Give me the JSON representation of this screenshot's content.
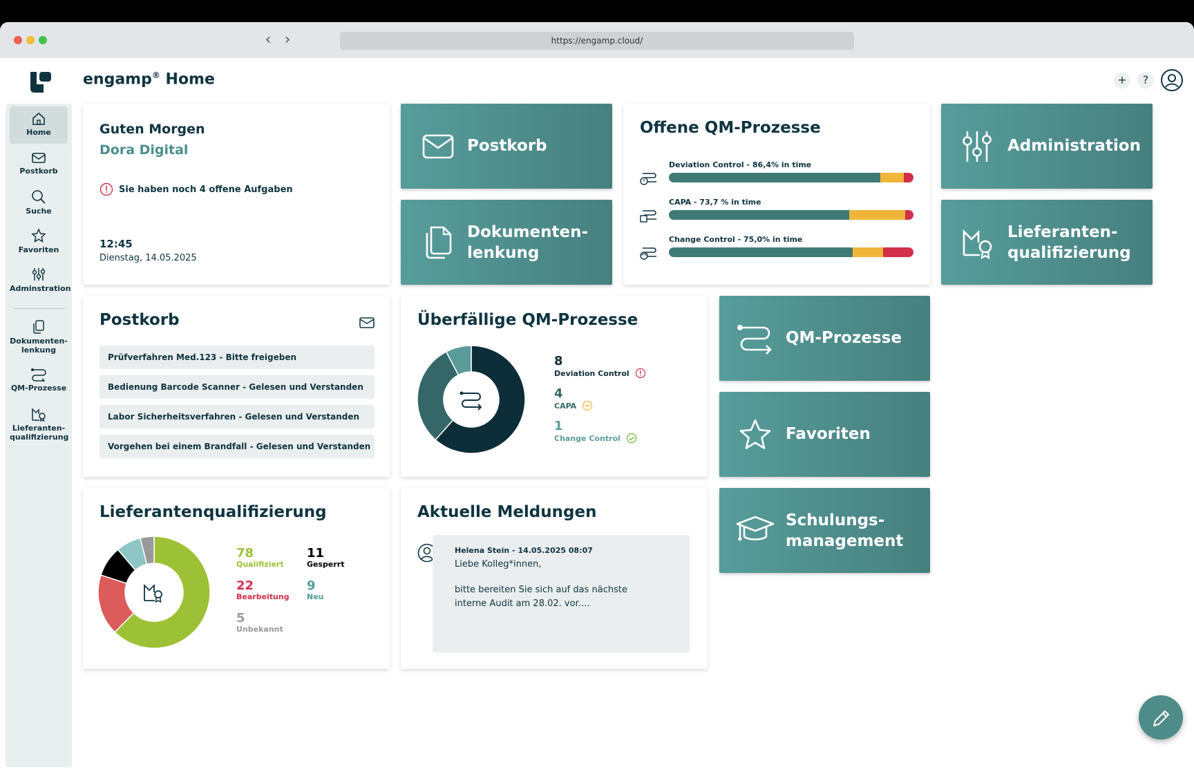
{
  "browser": {
    "url": "https://engamp.cloud/"
  },
  "header": {
    "app_name": "engamp",
    "reg_mark": "®",
    "page": "Home",
    "add_icon": "+",
    "help_icon": "?"
  },
  "sidebar": {
    "items": [
      {
        "label": "Home",
        "icon": "home-icon"
      },
      {
        "label": "Postkorb",
        "icon": "mail-icon"
      },
      {
        "label": "Suche",
        "icon": "search-icon"
      },
      {
        "label": "Favoriten",
        "icon": "star-icon"
      },
      {
        "label": "Adminstration",
        "icon": "sliders-icon"
      },
      {
        "label": "Dokumenten-lenkung",
        "icon": "documents-icon"
      },
      {
        "label": "QM-Prozesse",
        "icon": "process-icon"
      },
      {
        "label": "Lieferanten-qualifizierung",
        "icon": "supplier-icon"
      }
    ]
  },
  "welcome": {
    "greeting": "Guten Morgen",
    "user": "Dora Digital",
    "tasks": "Sie haben noch 4 offene Aufgaben",
    "time": "12:45",
    "date": "Dienstag, 14.05.2025"
  },
  "tiles": {
    "postkorb": "Postkorb",
    "dokumente_1": "Dokumenten-",
    "dokumente_2": "lenkung",
    "administration": "Administration",
    "lieferanten_1": "Lieferanten-",
    "lieferanten_2": "qualifizierung",
    "qm": "QM-Prozesse",
    "favoriten": "Favoriten",
    "schulung_1": "Schulungs-",
    "schulung_2": "management"
  },
  "open_qm": {
    "title": "Offene QM-Prozesse",
    "rows": [
      {
        "label": "Deviation Control - 86,4% in time",
        "green": 86.4,
        "yellow": 9.6,
        "red": 4.0
      },
      {
        "label": "CAPA - 73,7 % in time",
        "green": 73.7,
        "yellow": 23.0,
        "red": 3.3
      },
      {
        "label": "Change Control - 75,0% in time",
        "green": 75.0,
        "yellow": 12.5,
        "red": 12.5
      }
    ]
  },
  "postkorb_card": {
    "title": "Postkorb",
    "items": [
      "Prüfverfahren Med.123 - Bitte freigeben",
      "Bedienung Barcode Scanner - Gelesen und Verstanden",
      "Labor Sicherheitsverfahren - Gelesen und Verstanden",
      "Vorgehen bei einem Brandfall - Gelesen und Verstanden"
    ]
  },
  "overdue": {
    "title": "Überfällige QM-Prozesse",
    "stats": [
      {
        "num": "8",
        "label": "Deviation Control",
        "color": "#0d2e38"
      },
      {
        "num": "4",
        "label": "CAPA",
        "color": "#356769"
      },
      {
        "num": "1",
        "label": "Change Control",
        "color": "#5a9c9a"
      }
    ]
  },
  "suppliers": {
    "title": "Lieferantenqualifizierung",
    "stats": [
      {
        "num": "78",
        "label": "Qualifiziert",
        "color": "#9dc136"
      },
      {
        "num": "11",
        "label": "Gesperrt",
        "color": "#000000"
      },
      {
        "num": "22",
        "label": "Bearbeitung",
        "color": "#d2304a"
      },
      {
        "num": "9",
        "label": "Neu",
        "color": "#4b9e96"
      },
      {
        "num": "5",
        "label": "Unbekannt",
        "color": "#999999"
      }
    ]
  },
  "news": {
    "title": "Aktuelle Meldungen",
    "author": "Helena Stein - 14.05.2025 08:07",
    "line1": "Liebe Kolleg*innen,",
    "line2": "bitte bereiten Sie sich auf das nächste interne Audit am 28.02. vor.…"
  },
  "chart_data": [
    {
      "type": "pie",
      "title": "Überfällige QM-Prozesse",
      "categories": [
        "Deviation Control",
        "CAPA",
        "Change Control"
      ],
      "values": [
        8,
        4,
        1
      ],
      "colors": [
        "#0d2e38",
        "#356769",
        "#5a9c9a"
      ]
    },
    {
      "type": "pie",
      "title": "Lieferantenqualifizierung",
      "categories": [
        "Qualifiziert",
        "Bearbeitung",
        "Gesperrt",
        "Neu",
        "Unbekannt"
      ],
      "values": [
        78,
        22,
        11,
        9,
        5
      ],
      "colors": [
        "#9dc136",
        "#dc5b5b",
        "#000000",
        "#8ec5c5",
        "#999999"
      ]
    }
  ]
}
